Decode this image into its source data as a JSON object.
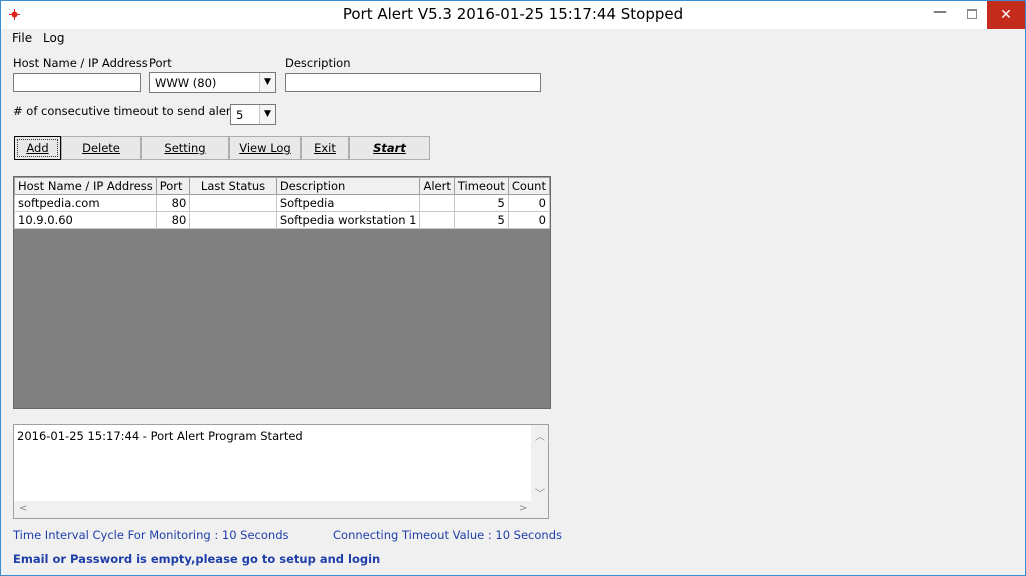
{
  "window": {
    "title": "Port Alert V5.3 2016-01-25 15:17:44 Stopped",
    "min_glyph": "—",
    "close_glyph": "✕"
  },
  "menu": [
    "File",
    "Log"
  ],
  "form": {
    "host_label": "Host Name / IP Address",
    "host_value": "",
    "port_label": "Port",
    "port_value": "WWW   (80)",
    "desc_label": "Description",
    "desc_value": "",
    "timeout_label": "# of consecutive timeout to send alert",
    "timeout_value": "5"
  },
  "buttons": {
    "add": "Add",
    "delete": "Delete",
    "setting": "Setting",
    "view_log": "View Log",
    "exit": "Exit",
    "start": "Start"
  },
  "grid": {
    "columns": [
      "Host Name / IP Address",
      "Port",
      "Last Status",
      "Description",
      "Alert",
      "Timeout",
      "Count"
    ],
    "rows": [
      [
        "softpedia.com",
        "80",
        "",
        "Softpedia",
        "",
        "5",
        "0"
      ],
      [
        "10.9.0.60",
        "80",
        "",
        "Softpedia workstation 1",
        "",
        "5",
        "0"
      ]
    ]
  },
  "log": {
    "text": "2016-01-25 15:17:44 - Port Alert Program Started"
  },
  "status": {
    "interval": "Time Interval Cycle For Monitoring : 10 Seconds",
    "timeout": "Connecting Timeout Value : 10 Seconds",
    "warning": "Email or Password is empty,please go to setup and login"
  },
  "colors": {
    "status_text": "#1f3fa8",
    "close_button": "#c42b1c",
    "grid_background": "#808080"
  }
}
